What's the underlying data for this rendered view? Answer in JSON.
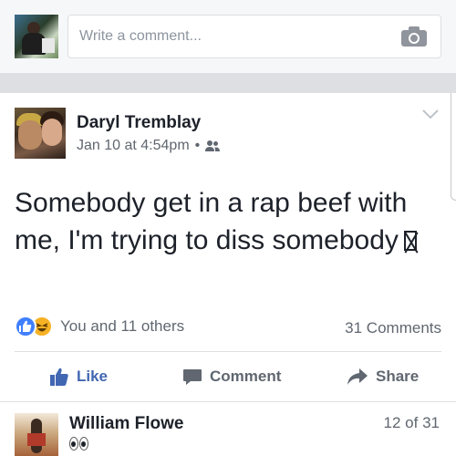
{
  "comment_box": {
    "placeholder": "Write a comment..."
  },
  "post": {
    "author": "Daryl Tremblay",
    "timestamp": "Jan 10 at 4:54pm",
    "meta_separator": "•",
    "audience_icon": "friends-icon",
    "text": "Somebody get in a rap beef with me, I'm trying to diss somebody",
    "trailing_glyph": "missing-emoji-box"
  },
  "reactions": {
    "types": [
      "like",
      "haha"
    ],
    "summary": "You and 11 others",
    "comments_count": "31 Comments"
  },
  "actions": {
    "like": "Like",
    "comment": "Comment",
    "share": "Share"
  },
  "comment_preview": {
    "name": "William Flowe",
    "content_emoji": "eyes",
    "counter": "12 of 31"
  },
  "colors": {
    "accent_blue": "#4267b2",
    "like_reaction": "#4080ff",
    "haha_reaction": "#f7b125",
    "secondary_text": "#606770",
    "divider": "#dddfe2"
  }
}
